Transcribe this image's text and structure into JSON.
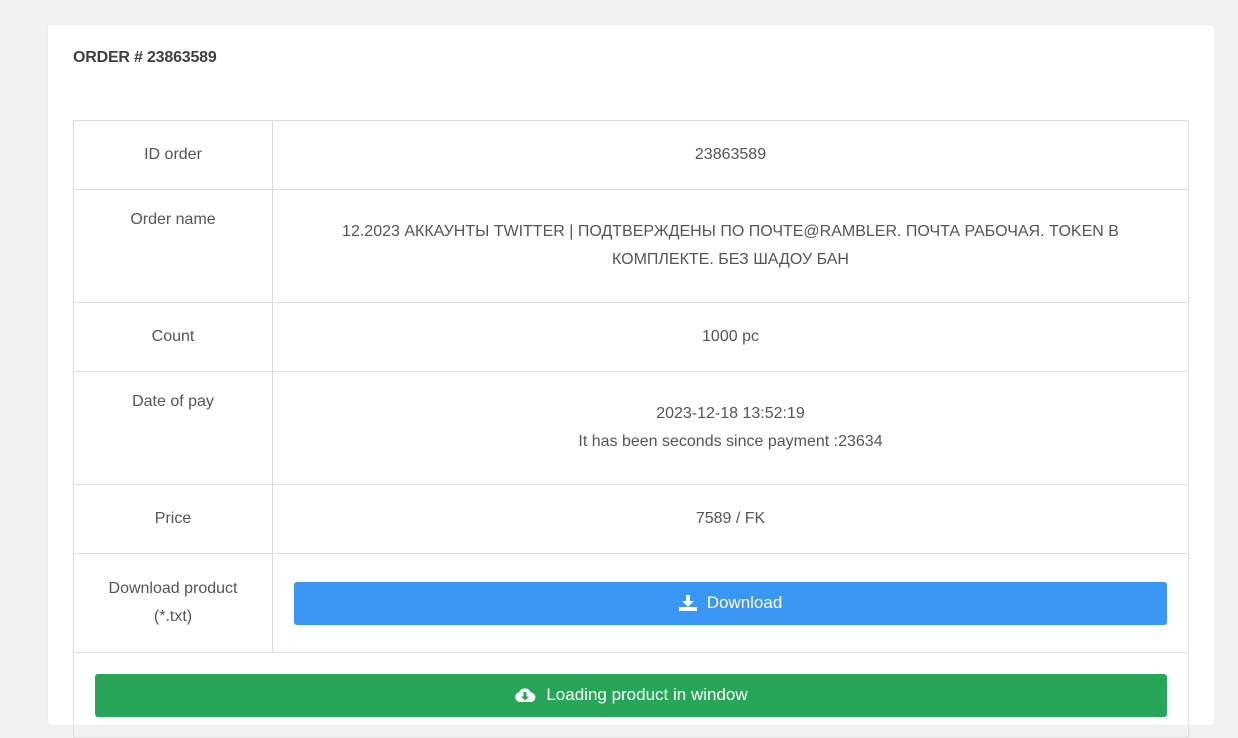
{
  "order": {
    "title": "ORDER # 23863589"
  },
  "rows": {
    "id": {
      "label": "ID order",
      "value": "23863589"
    },
    "name": {
      "label": "Order name",
      "value": "12.2023 АККАУНТЫ TWITTER | ПОДТВЕРЖДЕНЫ ПО ПОЧТЕ@RAMBLER. ПОЧТА РАБОЧАЯ. TOKEN В КОМПЛЕКТЕ. БЕЗ ШАДОУ БАН"
    },
    "count": {
      "label": "Count",
      "value": "1000 pc"
    },
    "date": {
      "label": "Date of pay",
      "value": "2023-12-18 13:52:19",
      "since": "It has been seconds since payment :23634"
    },
    "price": {
      "label": "Price",
      "value": "7589 / FK"
    },
    "download": {
      "label_line1": "Download product",
      "label_line2": "(*.txt)",
      "button_label": "Download",
      "button_icon": "download-icon",
      "button_color": "#3a96f3"
    }
  },
  "loading_button": {
    "label": "Loading product in window",
    "icon": "cloud-download-icon",
    "color": "#27a559"
  }
}
